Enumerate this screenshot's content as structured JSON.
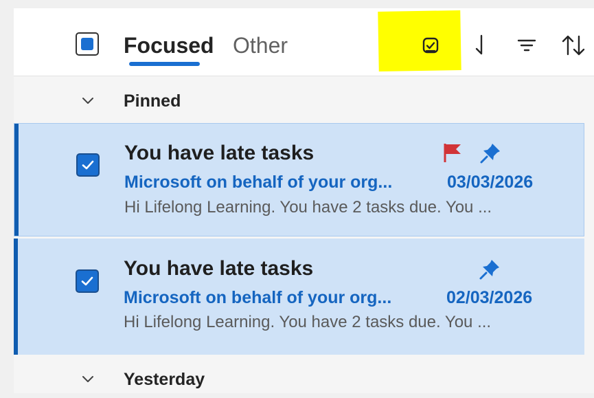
{
  "toolbar": {
    "tabs": [
      {
        "label": "Focused",
        "selected": true
      },
      {
        "label": "Other",
        "selected": false
      }
    ],
    "icons": [
      "select-all-checkbox",
      "task-icon",
      "down-arrow-icon",
      "filter-icon",
      "sort-icon"
    ],
    "highlight_color": "#ffff00"
  },
  "groups": {
    "pinned": {
      "label": "Pinned"
    },
    "yesterday": {
      "label": "Yesterday"
    }
  },
  "messages": [
    {
      "subject": "You have late tasks",
      "sender": "Microsoft on behalf of your org...",
      "date": "03/03/2026",
      "preview": "Hi Lifelong Learning. You have 2 tasks due. You ...",
      "flagged": true,
      "pinned": true,
      "selected": true
    },
    {
      "subject": "You have late tasks",
      "sender": "Microsoft on behalf of your org...",
      "date": "02/03/2026",
      "preview": "Hi Lifelong Learning. You have 2 tasks due. You ...",
      "flagged": false,
      "pinned": true,
      "selected": true
    }
  ],
  "colors": {
    "accent": "#1a6fd1",
    "selected_row": "#cfe2f7",
    "flag": "#d13438",
    "link_text": "#1565c0"
  }
}
